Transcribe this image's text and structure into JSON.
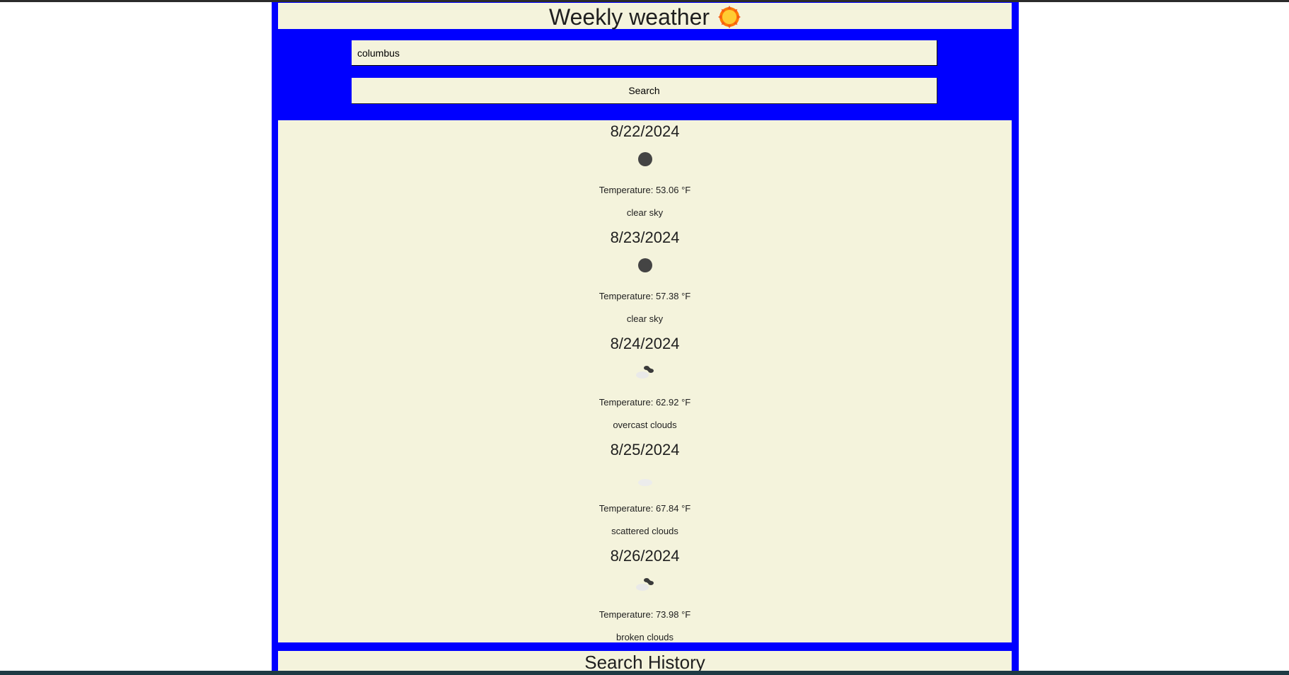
{
  "header": {
    "title": "Weekly weather",
    "icon": "sun-icon"
  },
  "search": {
    "value": "columbus",
    "button_label": "Search"
  },
  "forecast": {
    "days": [
      {
        "date": "8/22/2024",
        "temperature": "Temperature: 53.06 °F",
        "description": "clear sky",
        "icon": "moon-icon"
      },
      {
        "date": "8/23/2024",
        "temperature": "Temperature: 57.38 °F",
        "description": "clear sky",
        "icon": "moon-icon"
      },
      {
        "date": "8/24/2024",
        "temperature": "Temperature: 62.92 °F",
        "description": "overcast clouds",
        "icon": "overcast-clouds-icon"
      },
      {
        "date": "8/25/2024",
        "temperature": "Temperature: 67.84 °F",
        "description": "scattered clouds",
        "icon": "scattered-clouds-icon"
      },
      {
        "date": "8/26/2024",
        "temperature": "Temperature: 73.98 °F",
        "description": "broken clouds",
        "icon": "broken-clouds-icon"
      }
    ]
  },
  "history": {
    "title": "Search History"
  },
  "colors": {
    "frame": "#0000ff",
    "panel": "#f4f3dc",
    "text": "#1f1f1f"
  }
}
